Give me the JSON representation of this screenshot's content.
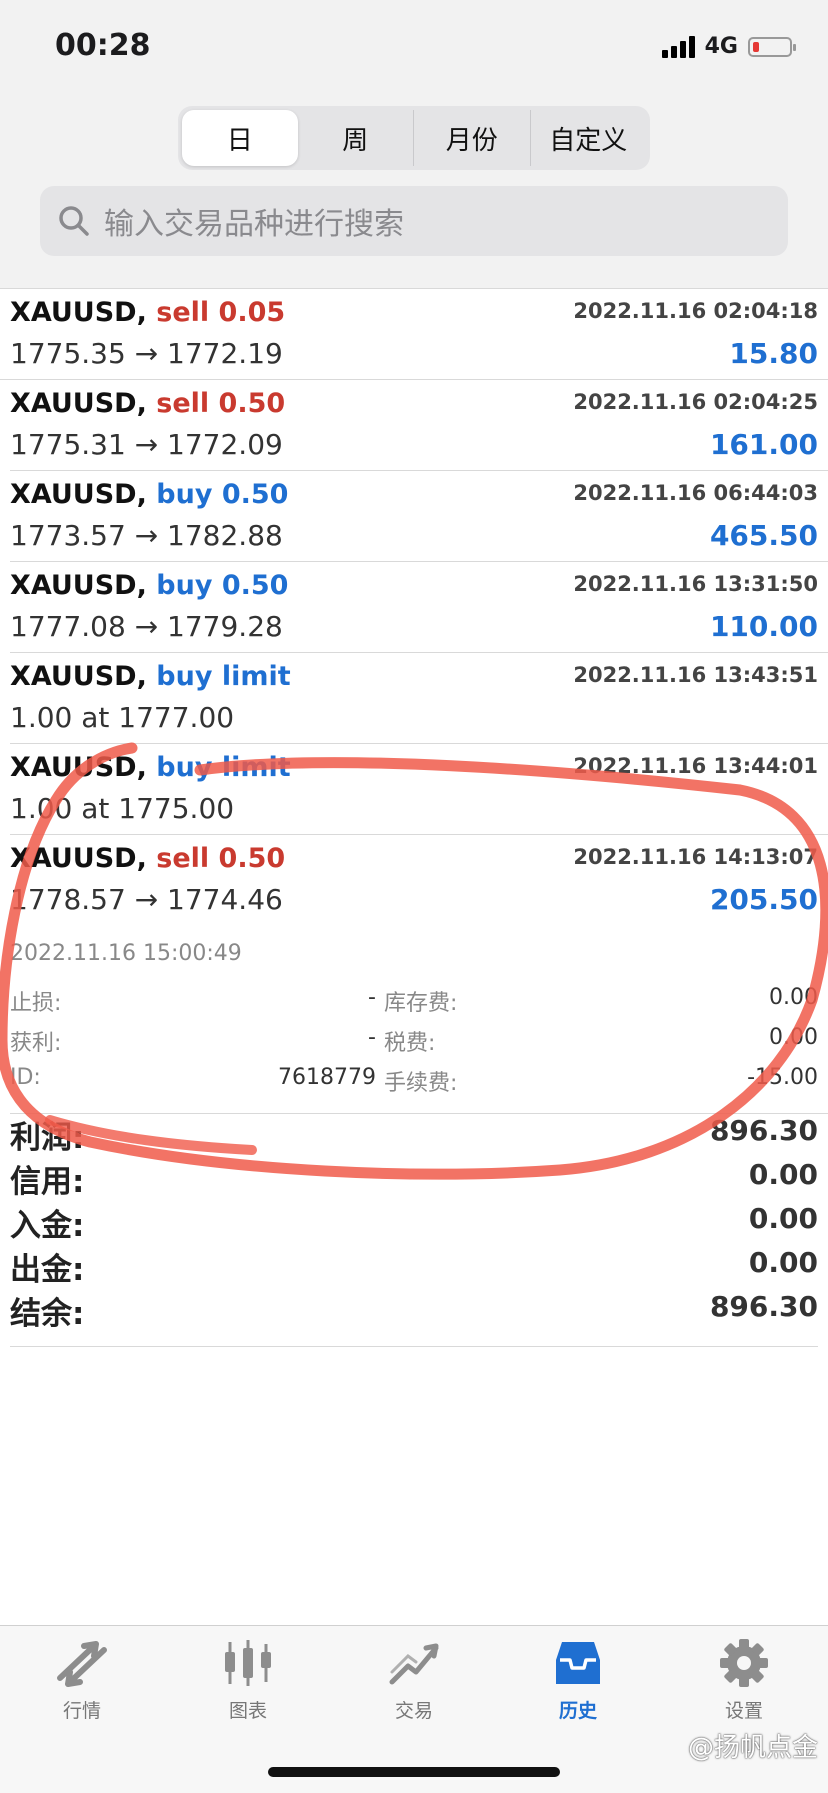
{
  "status": {
    "time": "00:28",
    "network": "4G"
  },
  "segments": [
    {
      "label": "日",
      "active": true
    },
    {
      "label": "周"
    },
    {
      "label": "月份"
    },
    {
      "label": "自定义"
    }
  ],
  "search": {
    "placeholder": "输入交易品种进行搜索"
  },
  "rows": [
    {
      "symbol": "XAUUSD,",
      "side": "sell 0.05",
      "side_type": "sell",
      "time": "2022.11.16 02:04:18",
      "price": "1775.35 → 1772.19",
      "profit": "15.80"
    },
    {
      "symbol": "XAUUSD,",
      "side": "sell 0.50",
      "side_type": "sell",
      "time": "2022.11.16 02:04:25",
      "price": "1775.31 → 1772.09",
      "profit": "161.00"
    },
    {
      "symbol": "XAUUSD,",
      "side": "buy 0.50",
      "side_type": "buy",
      "time": "2022.11.16 06:44:03",
      "price": "1773.57 → 1782.88",
      "profit": "465.50"
    },
    {
      "symbol": "XAUUSD,",
      "side": "buy 0.50",
      "side_type": "buy",
      "time": "2022.11.16 13:31:50",
      "price": "1777.08 → 1779.28",
      "profit": "110.00"
    },
    {
      "symbol": "XAUUSD,",
      "side": "buy limit",
      "side_type": "buy",
      "time": "2022.11.16 13:43:51",
      "price": "1.00 at 1777.00",
      "profit": ""
    },
    {
      "symbol": "XAUUSD,",
      "side": "buy limit",
      "side_type": "buy",
      "time": "2022.11.16 13:44:01",
      "price": "1.00 at 1775.00",
      "profit": ""
    }
  ],
  "expanded": {
    "symbol": "XAUUSD,",
    "side": "sell 0.50",
    "time": "2022.11.16 14:13:07",
    "price": "1778.57 → 1774.46",
    "profit": "205.50",
    "close_time": "2022.11.16 15:00:49",
    "stop_loss_label": "止损:",
    "stop_loss": "-",
    "take_profit_label": "获利:",
    "take_profit": "-",
    "id_label": "ID:",
    "id": "7618779",
    "swap_label": "库存费:",
    "swap": "0.00",
    "tax_label": "税费:",
    "tax": "0.00",
    "commission_label": "手续费:",
    "commission": "-15.00"
  },
  "summary": [
    {
      "label": "利润:",
      "value": "896.30"
    },
    {
      "label": "信用:",
      "value": "0.00"
    },
    {
      "label": "入金:",
      "value": "0.00"
    },
    {
      "label": "出金:",
      "value": "0.00"
    },
    {
      "label": "结余:",
      "value": "896.30"
    }
  ],
  "tabs": [
    {
      "label": "行情",
      "icon": "quotes-icon"
    },
    {
      "label": "图表",
      "icon": "chart-icon"
    },
    {
      "label": "交易",
      "icon": "trade-icon"
    },
    {
      "label": "历史",
      "icon": "history-icon",
      "active": true
    },
    {
      "label": "设置",
      "icon": "settings-icon"
    }
  ],
  "watermark": "@扬帆点金",
  "colors": {
    "sell": "#c93a2f",
    "buy": "#1f6fd1",
    "annotation": "#f05a4a"
  }
}
